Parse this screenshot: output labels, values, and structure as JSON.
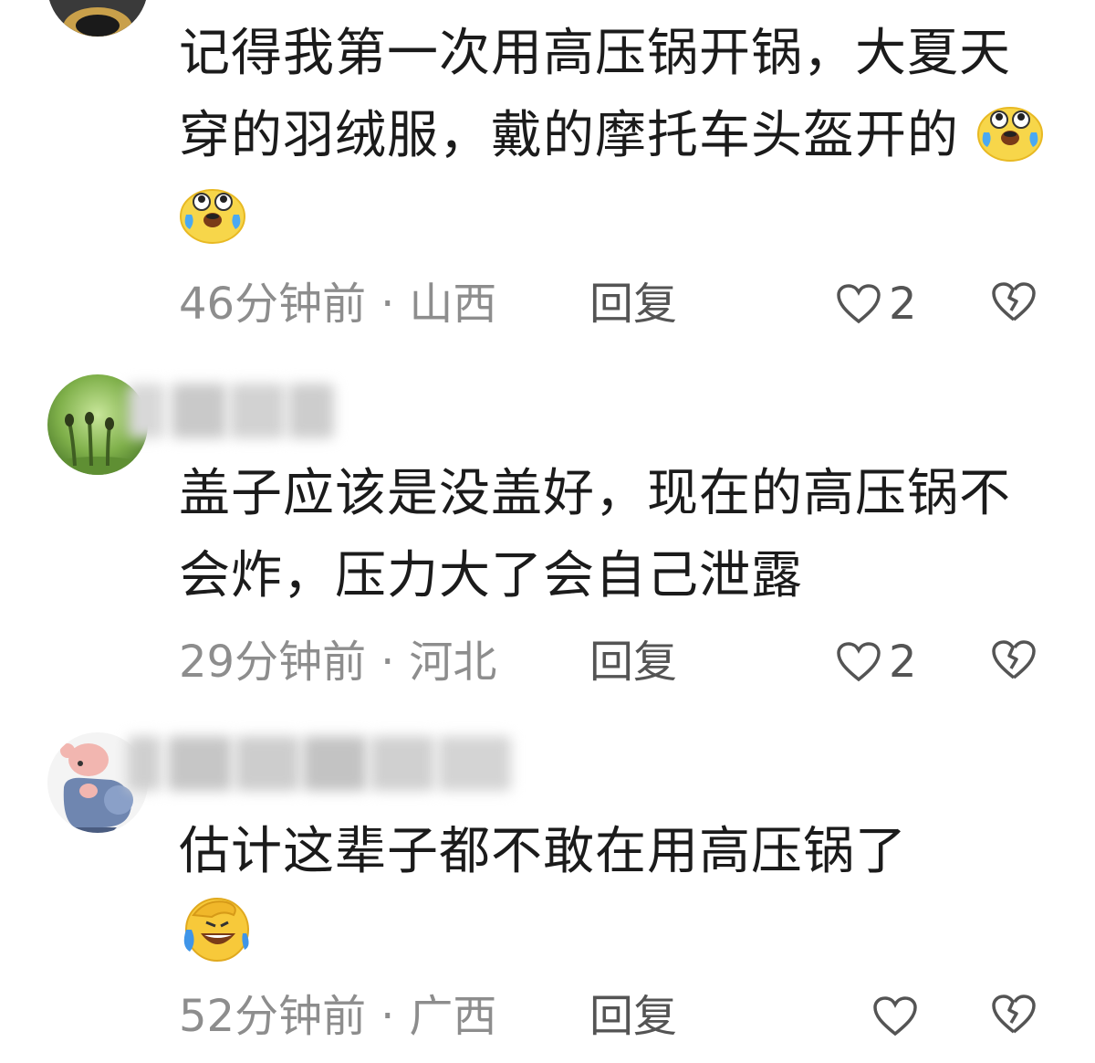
{
  "comments": [
    {
      "text": "记得我第一次用高压锅开锅，大夏天穿的羽绒服，戴的摩托车头盔开的",
      "emojis": [
        "crying-face-emoji",
        "crying-face-emoji"
      ],
      "time": "46分钟前",
      "separator": "·",
      "location": "山西",
      "reply_label": "回复",
      "likes": "2",
      "avatar_icon": "avatar-dark"
    },
    {
      "text": "盖子应该是没盖好，现在的高压锅不会炸，压力大了会自己泄露",
      "time": "29分钟前",
      "separator": "·",
      "location": "河北",
      "reply_label": "回复",
      "likes": "2",
      "avatar_icon": "avatar-green-sprouts"
    },
    {
      "text": "估计这辈子都不敢在用高压锅了",
      "emojis": [
        "facepalm-laughing-emoji"
      ],
      "time": "52分钟前",
      "separator": "·",
      "location": "广西",
      "reply_label": "回复",
      "avatar_icon": "avatar-pig-cartoon"
    }
  ],
  "colors": {
    "text": "#1b1b1b",
    "meta": "#8d8d8d",
    "action": "#545454"
  }
}
